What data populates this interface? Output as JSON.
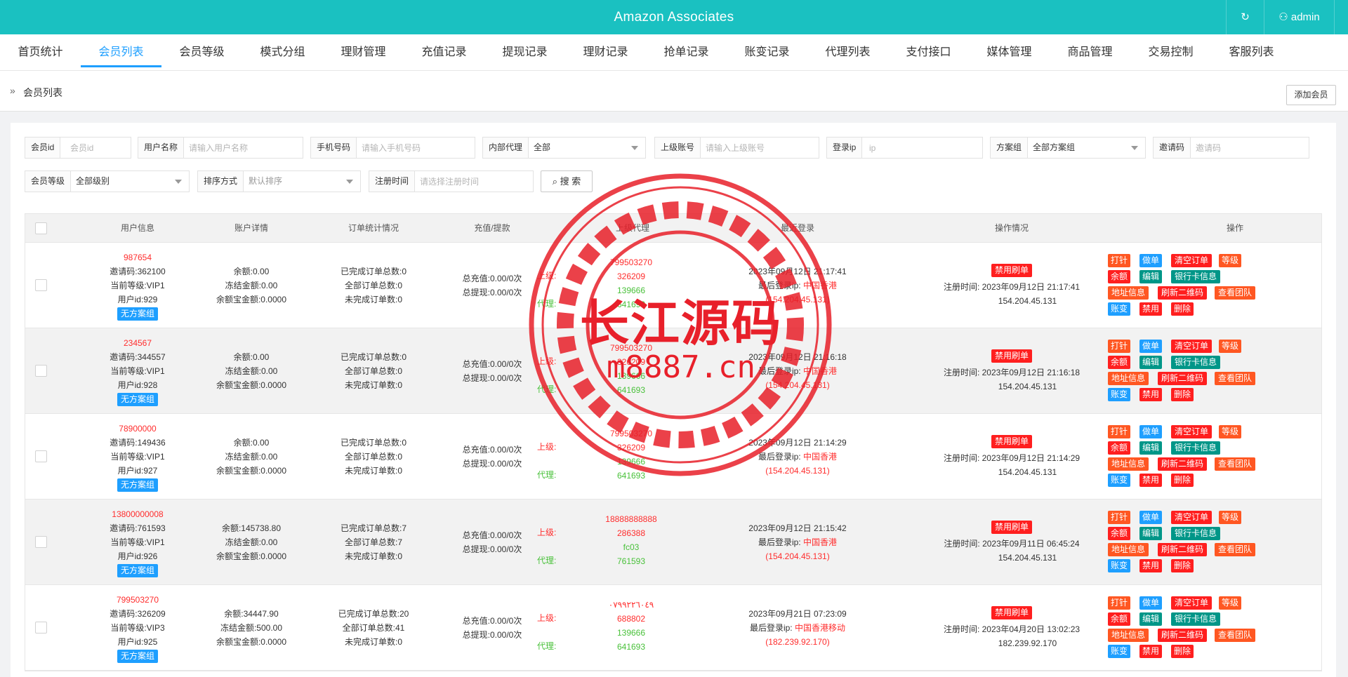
{
  "app": {
    "title": "Amazon Associates",
    "admin_label": "admin"
  },
  "nav": [
    "首页统计",
    "会员列表",
    "会员等级",
    "模式分组",
    "理财管理",
    "充值记录",
    "提现记录",
    "理财记录",
    "抢单记录",
    "账变记录",
    "代理列表",
    "支付接口",
    "媒体管理",
    "商品管理",
    "交易控制",
    "客服列表"
  ],
  "breadcrumb": {
    "current": "会员列表",
    "add_button": "添加会员"
  },
  "filters": {
    "member_id": {
      "label": "会员id",
      "placeholder": "会员id"
    },
    "username": {
      "label": "用户名称",
      "placeholder": "请输入用户名称"
    },
    "phone": {
      "label": "手机号码",
      "placeholder": "请输入手机号码"
    },
    "internal_agent": {
      "label": "内部代理",
      "value": "全部"
    },
    "parent_account": {
      "label": "上级账号",
      "placeholder": "请输入上级账号"
    },
    "login_ip": {
      "label": "登录ip",
      "placeholder": "ip"
    },
    "scheme_group": {
      "label": "方案组",
      "value": "全部方案组"
    },
    "invite_code": {
      "label": "邀请码",
      "placeholder": "邀请码"
    },
    "member_level": {
      "label": "会员等级",
      "value": "全部级别"
    },
    "sort": {
      "label": "排序方式",
      "value": "默认排序"
    },
    "reg_time": {
      "label": "注册时间",
      "placeholder": "请选择注册时间"
    },
    "search_button": "搜 索"
  },
  "table": {
    "headers": [
      "用户信息",
      "账户详情",
      "订单统计情况",
      "充值/提款",
      "上级代理",
      "最近登录",
      "操作情况",
      "操作"
    ],
    "ops_labels": {
      "dazhen": "打针",
      "zuodan": "做单",
      "clear": "清空订单",
      "level": "等级",
      "balance": "余额",
      "edit": "编辑",
      "bank": "银行卡信息",
      "address": "地址信息",
      "qrcode": "刷新二维码",
      "team": "查看团队",
      "change": "账变",
      "ban": "禁用",
      "delete": "删除"
    },
    "rows": [
      {
        "uid": "987654",
        "invite": "邀请码:362100",
        "vip": "当前等级:VIP1",
        "userid": "用户id:929",
        "scheme": "无方案组",
        "balance": "余额:0.00",
        "frozen": "冻结金额:0.00",
        "yeb": "余额宝金额:0.0000",
        "done": "已完成订单总数:0",
        "all": "全部订单总数:0",
        "undone": "未完成订单数:0",
        "recharge": "总充值:0.00/0次",
        "withdraw": "总提现:0.00/0次",
        "sup_label": "上级:",
        "sup1": "799503270",
        "sup2": "326209",
        "agent_label": "代理:",
        "ag1": "139666",
        "ag2": "641693",
        "last_time": "2023年09月12日 21:17:41",
        "last_ip_label": "最后登录ip:",
        "last_loc": "中国香港",
        "last_ip": "(154.204.45.131)",
        "ban_tag": "禁用刷单",
        "reg_label": "注册时间:",
        "reg_time": "2023年09月12日 21:17:41",
        "reg_ip": "154.204.45.131"
      },
      {
        "uid": "234567",
        "invite": "邀请码:344557",
        "vip": "当前等级:VIP1",
        "userid": "用户id:928",
        "scheme": "无方案组",
        "balance": "余额:0.00",
        "frozen": "冻结金额:0.00",
        "yeb": "余额宝金额:0.0000",
        "done": "已完成订单总数:0",
        "all": "全部订单总数:0",
        "undone": "未完成订单数:0",
        "recharge": "总充值:0.00/0次",
        "withdraw": "总提现:0.00/0次",
        "sup_label": "上级:",
        "sup1": "799503270",
        "sup2": "326209",
        "agent_label": "代理:",
        "ag1": "139666",
        "ag2": "641693",
        "last_time": "2023年09月12日 21:16:18",
        "last_ip_label": "最后登录ip:",
        "last_loc": "中国香港",
        "last_ip": "(154.204.45.131)",
        "ban_tag": "禁用刷单",
        "reg_label": "注册时间:",
        "reg_time": "2023年09月12日 21:16:18",
        "reg_ip": "154.204.45.131"
      },
      {
        "uid": "78900000",
        "invite": "邀请码:149436",
        "vip": "当前等级:VIP1",
        "userid": "用户id:927",
        "scheme": "无方案组",
        "balance": "余额:0.00",
        "frozen": "冻结金额:0.00",
        "yeb": "余额宝金额:0.0000",
        "done": "已完成订单总数:0",
        "all": "全部订单总数:0",
        "undone": "未完成订单数:0",
        "recharge": "总充值:0.00/0次",
        "withdraw": "总提现:0.00/0次",
        "sup_label": "上级:",
        "sup1": "799503270",
        "sup2": "326209",
        "agent_label": "代理:",
        "ag1": "139666",
        "ag2": "641693",
        "last_time": "2023年09月12日 21:14:29",
        "last_ip_label": "最后登录ip:",
        "last_loc": "中国香港",
        "last_ip": "(154.204.45.131)",
        "ban_tag": "禁用刷单",
        "reg_label": "注册时间:",
        "reg_time": "2023年09月12日 21:14:29",
        "reg_ip": "154.204.45.131"
      },
      {
        "uid": "13800000008",
        "invite": "邀请码:761593",
        "vip": "当前等级:VIP1",
        "userid": "用户id:926",
        "scheme": "无方案组",
        "balance": "余额:145738.80",
        "frozen": "冻结金额:0.00",
        "yeb": "余额宝金额:0.0000",
        "done": "已完成订单总数:7",
        "all": "全部订单总数:7",
        "undone": "未完成订单数:0",
        "recharge": "总充值:0.00/0次",
        "withdraw": "总提现:0.00/0次",
        "sup_label": "上级:",
        "sup1": "18888888888",
        "sup2": "286388",
        "agent_label": "代理:",
        "ag1": "fc03",
        "ag2": "761593",
        "last_time": "2023年09月12日 21:15:42",
        "last_ip_label": "最后登录ip:",
        "last_loc": "中国香港",
        "last_ip": "(154.204.45.131)",
        "ban_tag": "禁用刷单",
        "reg_label": "注册时间:",
        "reg_time": "2023年09月11日 06:45:24",
        "reg_ip": "154.204.45.131"
      },
      {
        "uid": "799503270",
        "invite": "邀请码:326209",
        "vip": "当前等级:VIP3",
        "userid": "用户id:925",
        "scheme": "无方案组",
        "balance": "余额:34447.90",
        "frozen": "冻结金额:500.00",
        "yeb": "余额宝金额:0.0000",
        "done": "已完成订单总数:20",
        "all": "全部订单总数:41",
        "undone": "未完成订单数:0",
        "recharge": "总充值:0.00/0次",
        "withdraw": "总提现:0.00/0次",
        "sup_label": "上级:",
        "sup1": "٠٧٩٩٢٢٦٠٤٩",
        "sup2": "688802",
        "agent_label": "代理:",
        "ag1": "139666",
        "ag2": "641693",
        "last_time": "2023年09月21日 07:23:09",
        "last_ip_label": "最后登录ip:",
        "last_loc": "中国香港移动",
        "last_ip": "(182.239.92.170)",
        "ban_tag": "禁用刷单",
        "reg_label": "注册时间:",
        "reg_time": "2023年04月20日 13:02:23",
        "reg_ip": "182.239.92.170"
      }
    ]
  },
  "watermark": {
    "title": "长江源码",
    "site": "m8887.cn"
  },
  "colors": {
    "topbar": "#1ac1c1",
    "blue": "#1e9fff",
    "orange": "#ff5722",
    "red": "#ff1f1f",
    "teal": "#009688",
    "green": "#49c13a"
  }
}
